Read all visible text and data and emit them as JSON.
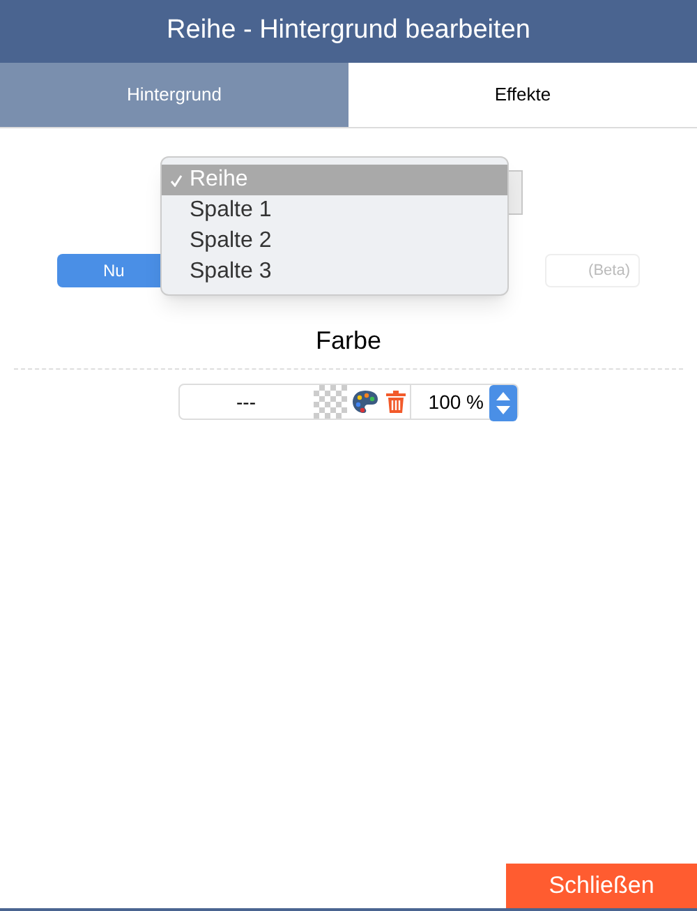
{
  "window": {
    "title": "Reihe - Hintergrund bearbeiten"
  },
  "tabs": [
    {
      "label": "Hintergrund",
      "selected": true
    },
    {
      "label": "Effekte",
      "selected": false
    }
  ],
  "target_select": {
    "options": [
      {
        "label": "Reihe",
        "selected": true
      },
      {
        "label": "Spalte 1",
        "selected": false
      },
      {
        "label": "Spalte 2",
        "selected": false
      },
      {
        "label": "Spalte 3",
        "selected": false
      }
    ]
  },
  "mode_buttons": [
    {
      "label": "Nu",
      "selected": true
    },
    {
      "label": "(Beta)",
      "selected": false
    }
  ],
  "color_section": {
    "heading": "Farbe",
    "value": "---",
    "opacity": "100 %"
  },
  "close_button": "Schließen"
}
